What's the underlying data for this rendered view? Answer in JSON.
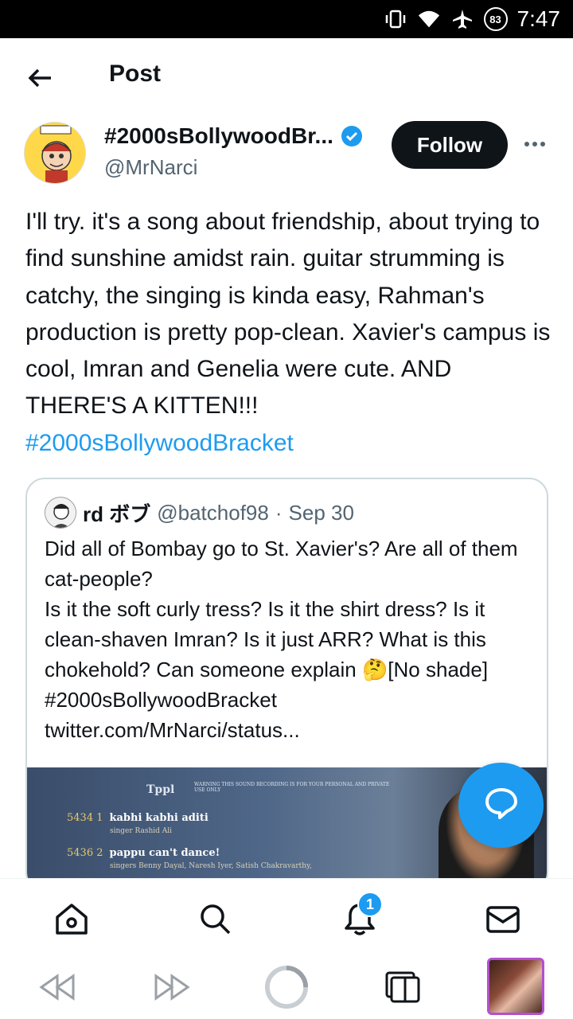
{
  "status_bar": {
    "time": "7:47",
    "battery": "83"
  },
  "header": {
    "title": "Post"
  },
  "author": {
    "name": "#2000sBollywoodBr...",
    "handle": "@MrNarci",
    "follow_label": "Follow"
  },
  "post": {
    "text": "I'll try. it's a song about friendship, about trying to find sunshine amidst rain. guitar strumming is catchy, the singing is kinda easy, Rahman's production is pretty pop-clean. Xavier's campus is cool, Imran and Genelia were cute. AND THERE'S A KITTEN!!!",
    "hashtag": "#2000sBollywoodBracket"
  },
  "quote": {
    "name": "rd ボブ",
    "handle": "@batchof98",
    "separator": "·",
    "date": "Sep 30",
    "lines": [
      "Did all of Bombay go to St. Xavier's? Are all of them cat-people?",
      "Is it the soft curly tress? Is it the shirt dress? Is it clean-shaven Imran? Is it just ARR? What is this chokehold? Can someone explain 🤔[No shade] #2000sBollywoodBracket",
      "twitter.com/MrNarci/status..."
    ],
    "image": {
      "logo": "Tppl",
      "warning": "WARNING THIS SOUND RECORDING IS FOR YOUR PERSONAL AND PRIVATE USE ONLY",
      "track1_num": "5434 1",
      "track1_title": "kabhi kabhi aditi",
      "track1_sub": "singer Rashid Ali",
      "track2_num": "5436 2",
      "track2_title": "pappu can't dance!",
      "track2_sub": "singers Benny Dayal, Naresh Iyer, Satish Chakravarthy,"
    }
  },
  "bottom_nav": {
    "notifications_badge": "1",
    "items": [
      "home-icon",
      "search-icon",
      "notifications-icon",
      "messages-icon"
    ]
  },
  "colors": {
    "accent": "#1d9bf0",
    "text": "#0f1419",
    "muted": "#536471"
  }
}
